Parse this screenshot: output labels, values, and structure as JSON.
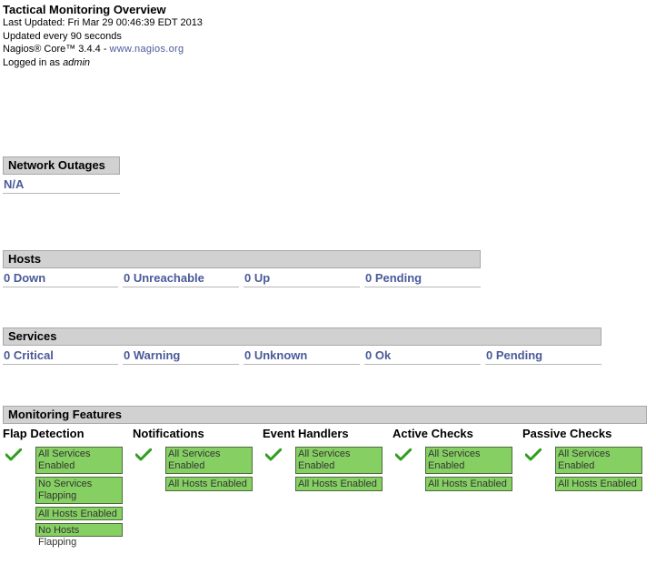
{
  "header": {
    "title": "Tactical Monitoring Overview",
    "last_updated": "Last Updated: Fri Mar 29 00:46:39 EDT 2013",
    "refresh": "Updated every 90 seconds",
    "product_prefix": "Nagios® Core™ 3.4.4 - ",
    "product_link": "www.nagios.org",
    "logged_prefix": "Logged in as ",
    "user": "admin"
  },
  "network_outages": {
    "heading": "Network Outages",
    "value": "N/A"
  },
  "hosts": {
    "heading": "Hosts",
    "cells": [
      "0 Down",
      "0 Unreachable",
      "0 Up",
      "0 Pending"
    ]
  },
  "services": {
    "heading": "Services",
    "cells": [
      "0 Critical",
      "0 Warning",
      "0 Unknown",
      "0 Ok",
      "0 Pending"
    ]
  },
  "features": {
    "heading": "Monitoring Features",
    "groups": [
      {
        "title": "Flap Detection",
        "items": [
          "All Services Enabled",
          "No Services Flapping",
          "All Hosts Enabled",
          "No Hosts Flapping"
        ]
      },
      {
        "title": "Notifications",
        "items": [
          "All Services Enabled",
          "All Hosts Enabled"
        ]
      },
      {
        "title": "Event Handlers",
        "items": [
          "All Services Enabled",
          "All Hosts Enabled"
        ]
      },
      {
        "title": "Active Checks",
        "items": [
          "All Services Enabled",
          "All Hosts Enabled"
        ]
      },
      {
        "title": "Passive Checks",
        "items": [
          "All Services Enabled",
          "All Hosts Enabled"
        ]
      }
    ]
  },
  "colors": {
    "enabled_green": "#86d063",
    "link_blue": "#4a5a9a",
    "header_gray": "#d1d1d1",
    "check_green": "#2e9e1c"
  },
  "icons": {
    "status": "check-icon"
  }
}
